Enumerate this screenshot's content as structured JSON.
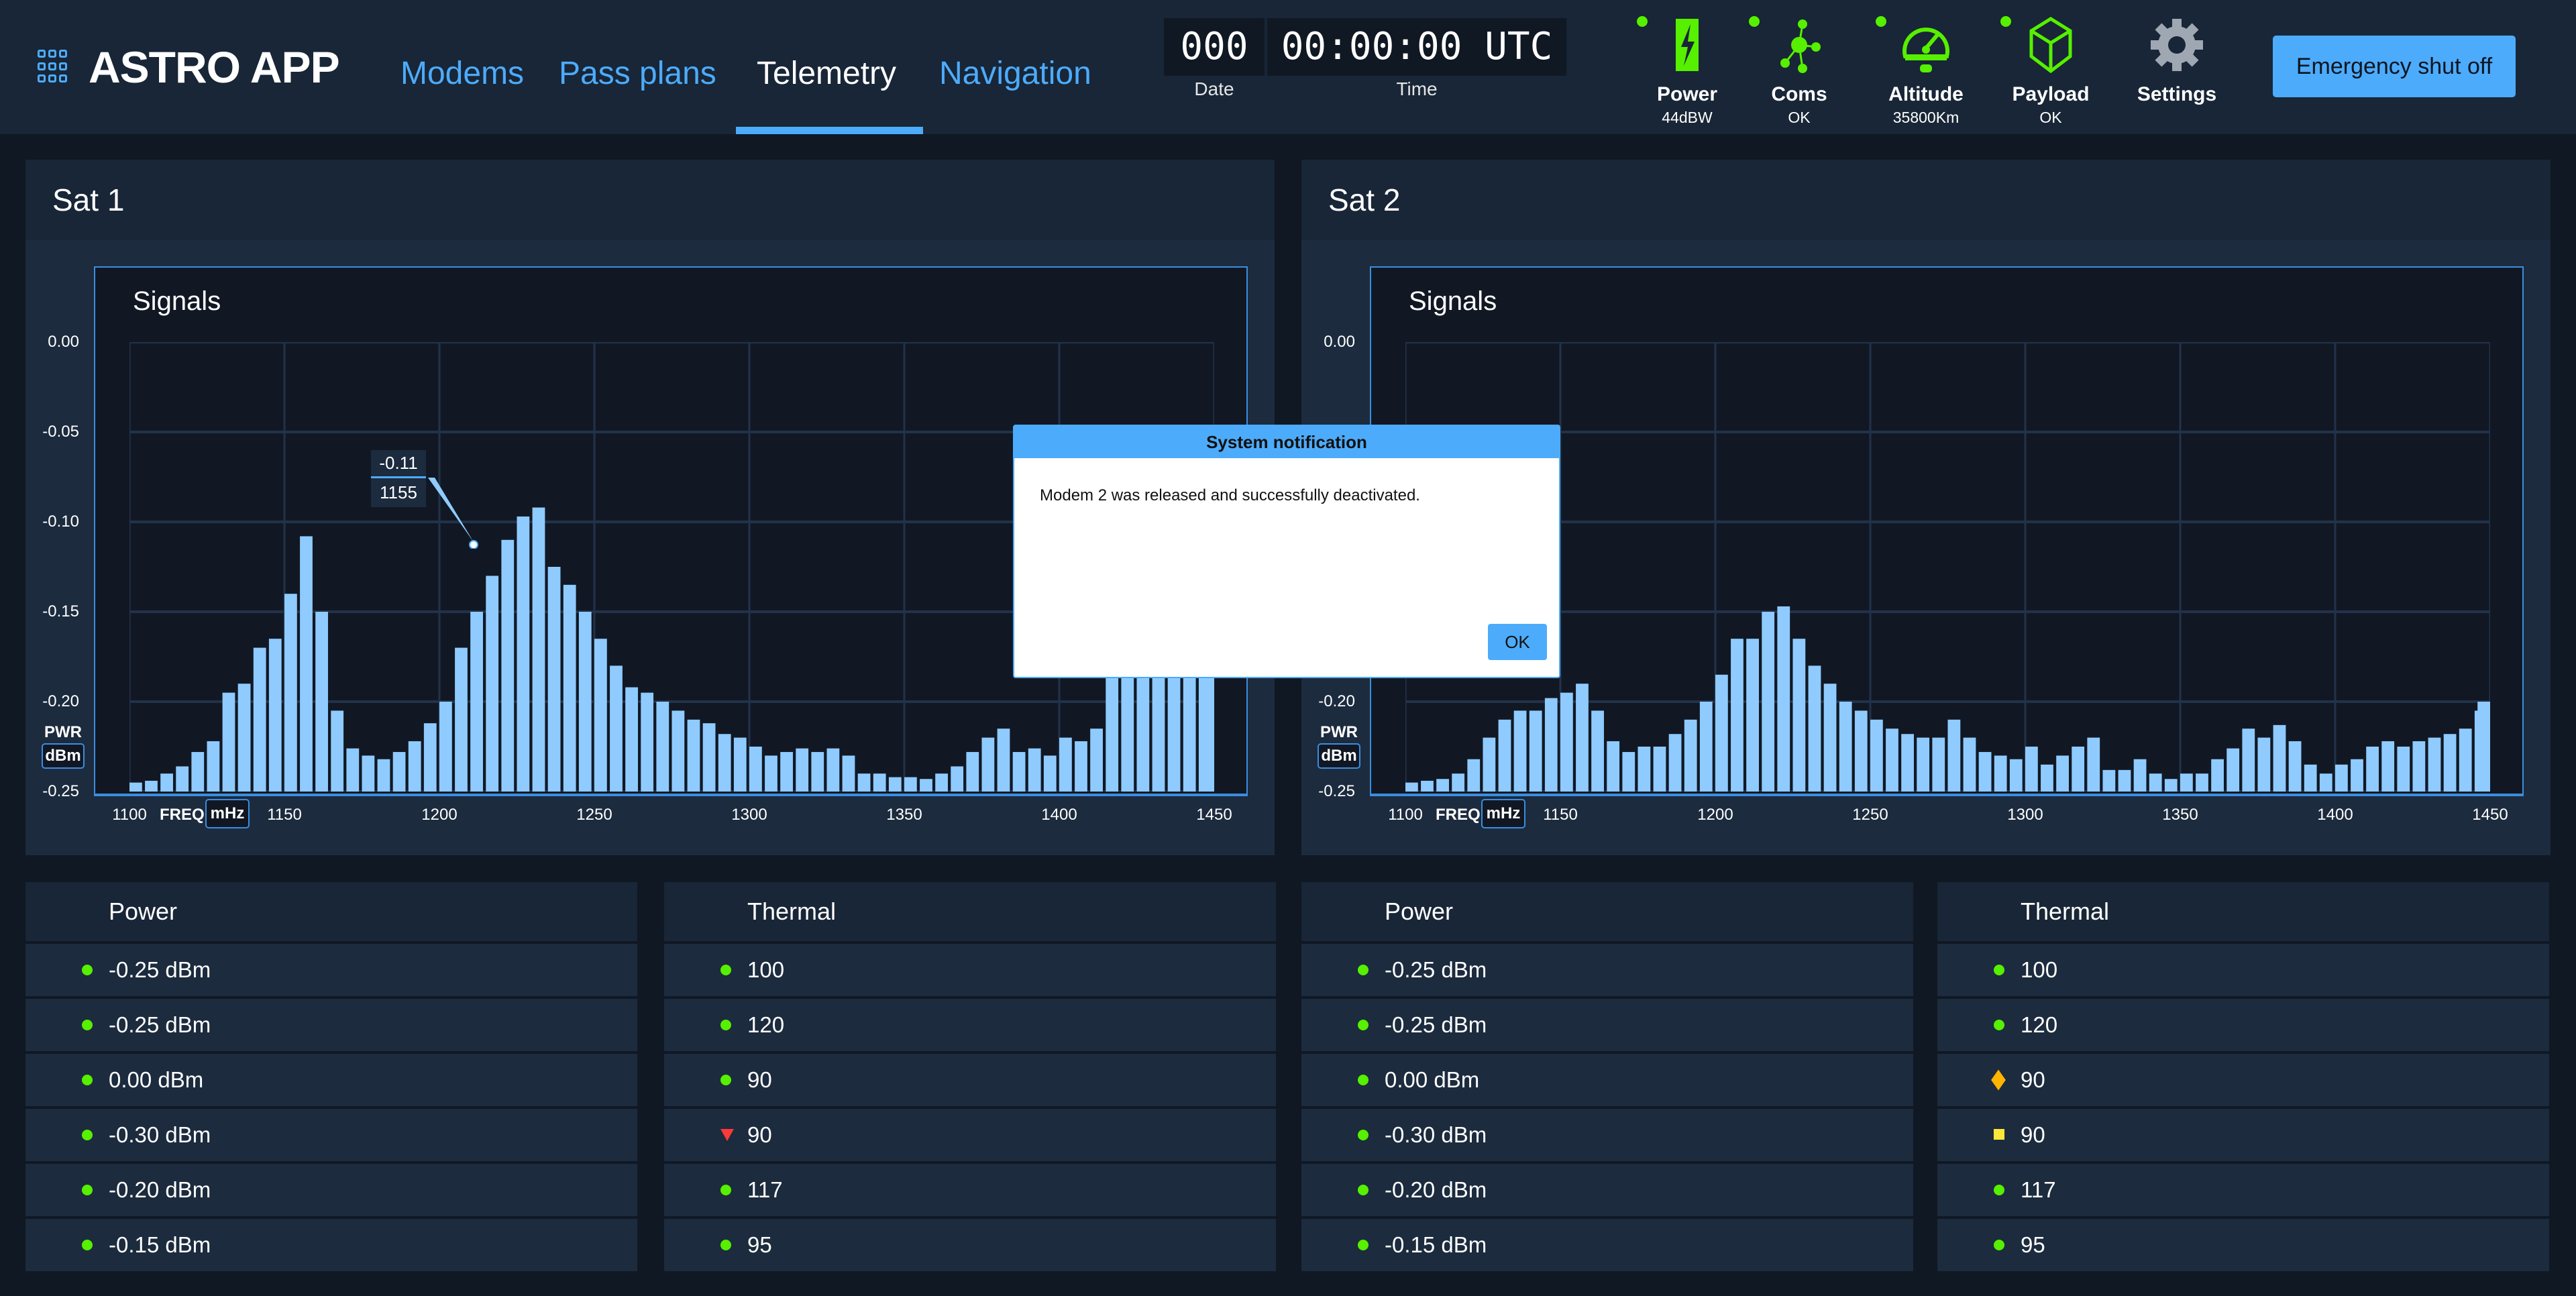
{
  "app": {
    "title": "ASTRO APP"
  },
  "nav": {
    "tabs": [
      {
        "label": "Modems"
      },
      {
        "label": "Pass plans"
      },
      {
        "label": "Telemetry",
        "active": true
      },
      {
        "label": "Navigation"
      }
    ]
  },
  "clock": {
    "date_value": "000",
    "time_value": "00:00:00 UTC",
    "date_label": "Date",
    "time_label": "Time"
  },
  "status": [
    {
      "label": "Power",
      "sub": "44dBW",
      "icon": "power-bolt-icon"
    },
    {
      "label": "Coms",
      "sub": "OK",
      "icon": "network-nodes-icon"
    },
    {
      "label": "Altitude",
      "sub": "35800Km",
      "icon": "gauge-icon"
    },
    {
      "label": "Payload",
      "sub": "OK",
      "icon": "cube-icon"
    },
    {
      "label": "Settings",
      "sub": "",
      "icon": "gear-icon"
    }
  ],
  "emergency_label": "Emergency shut off",
  "colors": {
    "accent": "#4dabfb",
    "ok": "#56f000",
    "critical": "#ff3838",
    "serious": "#ffb302",
    "caution": "#fce83a",
    "bars": "#8fcbff"
  },
  "panels": [
    {
      "title": "Sat 1"
    },
    {
      "title": "Sat 2"
    }
  ],
  "tooltip": {
    "value": "-0.11",
    "freq": "1155"
  },
  "chart_data": [
    {
      "type": "bar",
      "title": "Signals",
      "ylabel": "PWR",
      "yunit": "dBm",
      "xlabel": "FREQ",
      "xunit": "mHz",
      "ylim": [
        -0.25,
        0
      ],
      "xlim": [
        1100,
        1450
      ],
      "grid": true,
      "yticks": [
        "0.00",
        "-0.05",
        "-0.10",
        "-0.15",
        "-0.20",
        "-0.25"
      ],
      "xticks": [
        "1100",
        "1150",
        "1200",
        "1250",
        "1300",
        "1350",
        "1400",
        "1450"
      ],
      "x_start": 1100,
      "x_step": 5,
      "values": [
        -0.245,
        -0.244,
        -0.24,
        -0.236,
        -0.228,
        -0.222,
        -0.195,
        -0.19,
        -0.17,
        -0.165,
        -0.14,
        -0.108,
        -0.15,
        -0.205,
        -0.226,
        -0.23,
        -0.232,
        -0.228,
        -0.222,
        -0.212,
        -0.2,
        -0.17,
        -0.15,
        -0.13,
        -0.11,
        -0.097,
        -0.092,
        -0.125,
        -0.135,
        -0.15,
        -0.165,
        -0.18,
        -0.192,
        -0.195,
        -0.2,
        -0.205,
        -0.21,
        -0.212,
        -0.218,
        -0.22,
        -0.225,
        -0.23,
        -0.228,
        -0.226,
        -0.228,
        -0.226,
        -0.23,
        -0.24,
        -0.24,
        -0.242,
        -0.242,
        -0.243,
        -0.24,
        -0.236,
        -0.228,
        -0.22,
        -0.215,
        -0.228,
        -0.226,
        -0.23,
        -0.22,
        -0.222,
        -0.215,
        -0.17,
        -0.168,
        -0.17,
        -0.168,
        -0.17,
        -0.168,
        -0.17,
        -0.17
      ]
    },
    {
      "type": "bar",
      "title": "Signals",
      "ylabel": "PWR",
      "yunit": "dBm",
      "xlabel": "FREQ",
      "xunit": "mHz",
      "ylim": [
        -0.25,
        0
      ],
      "xlim": [
        1100,
        1450
      ],
      "grid": true,
      "yticks": [
        "0.00",
        "-0.05",
        "-0.10",
        "-0.15",
        "-0.20",
        "-0.25"
      ],
      "xticks": [
        "1100",
        "1150",
        "1200",
        "1250",
        "1300",
        "1350",
        "1400",
        "1450"
      ],
      "x_start": 1100,
      "x_step": 5,
      "values": [
        -0.245,
        -0.244,
        -0.243,
        -0.24,
        -0.232,
        -0.22,
        -0.21,
        -0.205,
        -0.205,
        -0.198,
        -0.195,
        -0.19,
        -0.205,
        -0.222,
        -0.228,
        -0.225,
        -0.225,
        -0.218,
        -0.21,
        -0.2,
        -0.185,
        -0.165,
        -0.165,
        -0.15,
        -0.147,
        -0.165,
        -0.18,
        -0.19,
        -0.2,
        -0.205,
        -0.21,
        -0.215,
        -0.218,
        -0.22,
        -0.22,
        -0.21,
        -0.22,
        -0.228,
        -0.23,
        -0.232,
        -0.225,
        -0.235,
        -0.23,
        -0.225,
        -0.22,
        -0.238,
        -0.238,
        -0.232,
        -0.24,
        -0.243,
        -0.24,
        -0.24,
        -0.232,
        -0.226,
        -0.215,
        -0.22,
        -0.213,
        -0.222,
        -0.235,
        -0.24,
        -0.235,
        -0.232,
        -0.225,
        -0.222,
        -0.225,
        -0.222,
        -0.22,
        -0.218,
        -0.215,
        -0.205,
        -0.2
      ]
    }
  ],
  "tables": [
    {
      "title": "Power",
      "rows": [
        {
          "v": "-0.25 dBm",
          "s": "ok"
        },
        {
          "v": "-0.25 dBm",
          "s": "ok"
        },
        {
          "v": "0.00 dBm",
          "s": "ok"
        },
        {
          "v": "-0.30 dBm",
          "s": "ok"
        },
        {
          "v": "-0.20 dBm",
          "s": "ok"
        },
        {
          "v": "-0.15 dBm",
          "s": "ok"
        }
      ]
    },
    {
      "title": "Thermal",
      "rows": [
        {
          "v": "100",
          "s": "ok"
        },
        {
          "v": "120",
          "s": "ok"
        },
        {
          "v": "90",
          "s": "ok"
        },
        {
          "v": "90",
          "s": "critical"
        },
        {
          "v": "117",
          "s": "ok"
        },
        {
          "v": "95",
          "s": "ok"
        }
      ]
    },
    {
      "title": "Power",
      "rows": [
        {
          "v": "-0.25 dBm",
          "s": "ok"
        },
        {
          "v": "-0.25 dBm",
          "s": "ok"
        },
        {
          "v": "0.00 dBm",
          "s": "ok"
        },
        {
          "v": "-0.30 dBm",
          "s": "ok"
        },
        {
          "v": "-0.20 dBm",
          "s": "ok"
        },
        {
          "v": "-0.15 dBm",
          "s": "ok"
        }
      ]
    },
    {
      "title": "Thermal",
      "rows": [
        {
          "v": "100",
          "s": "ok"
        },
        {
          "v": "120",
          "s": "ok"
        },
        {
          "v": "90",
          "s": "serious"
        },
        {
          "v": "90",
          "s": "caution"
        },
        {
          "v": "117",
          "s": "ok"
        },
        {
          "v": "95",
          "s": "ok"
        }
      ]
    }
  ],
  "dialog": {
    "title": "System notification",
    "message": "Modem 2 was released and successfully deactivated.",
    "ok_label": "OK"
  }
}
